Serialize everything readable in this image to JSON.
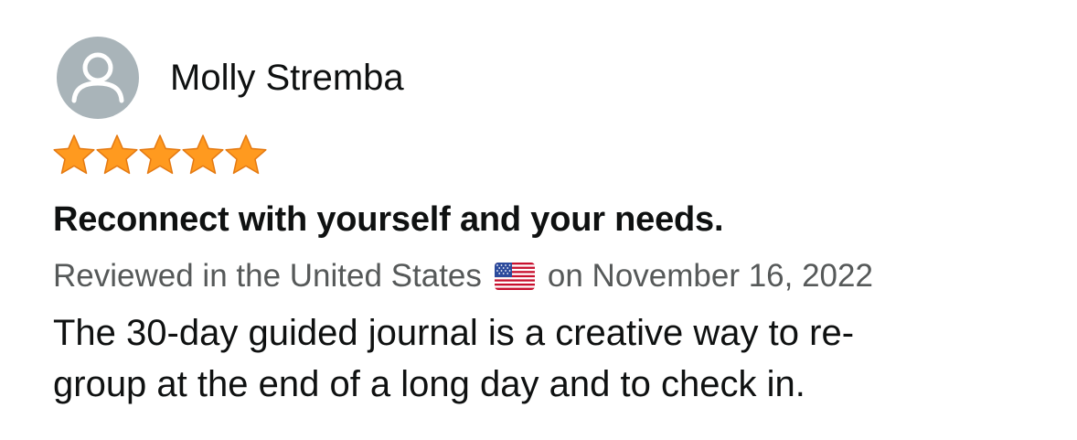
{
  "review": {
    "author": "Molly Stremba",
    "avatar_icon": "default-user-avatar-icon",
    "rating": 5,
    "rating_max": 5,
    "star_color": "#ff9a1f",
    "star_outline": "#e47911",
    "title": "Reconnect with yourself and your needs.",
    "meta": {
      "prefix": "Reviewed in the United States",
      "flag_icon": "us-flag-icon",
      "suffix": "on November 16, 2022"
    },
    "body_lines": [
      "The 30-day guided journal is a creative way to re-",
      "group at the end of a long day and to check in."
    ]
  }
}
